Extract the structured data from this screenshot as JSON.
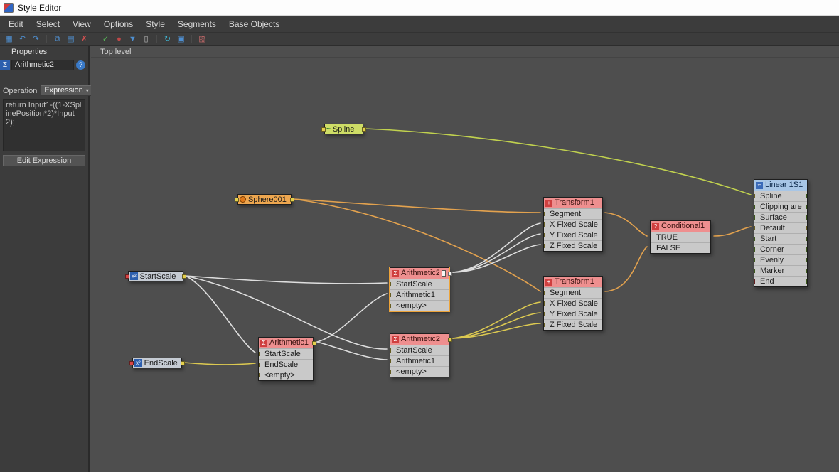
{
  "window": {
    "title": "Style Editor"
  },
  "menubar": {
    "items": [
      "Edit",
      "Select",
      "View",
      "Options",
      "Style",
      "Segments",
      "Base Objects"
    ]
  },
  "toolbar": {
    "icons": [
      {
        "name": "compare",
        "glyph": "▦",
        "css": "color:#4f8fd0"
      },
      {
        "name": "undo",
        "glyph": "↶",
        "css": "color:#4f8fd0"
      },
      {
        "name": "redo",
        "glyph": "↷",
        "css": "color:#4f8fd0"
      },
      {
        "name": "copy",
        "glyph": "⧉",
        "css": "color:#4f8fd0"
      },
      {
        "name": "paste",
        "glyph": "▤",
        "css": "color:#4f8fd0"
      },
      {
        "name": "delete",
        "glyph": "✗",
        "css": "color:#d05050"
      },
      {
        "name": "apply",
        "glyph": "✓",
        "css": "color:#58b858"
      },
      {
        "name": "mute",
        "glyph": "●",
        "css": "color:#c04848"
      },
      {
        "name": "filter",
        "glyph": "▼",
        "css": "color:#4f8fd0"
      },
      {
        "name": "trash",
        "glyph": "▯",
        "css": "color:#b8b8b8"
      },
      {
        "name": "refresh",
        "glyph": "↻",
        "css": "color:#3fb3d0"
      },
      {
        "name": "frame",
        "glyph": "▣",
        "css": "color:#4f8fd0"
      },
      {
        "name": "layout",
        "glyph": "▧",
        "css": "color:#c06868"
      }
    ]
  },
  "panel": {
    "tab": "Properties",
    "node_name": "Arithmetic2",
    "operation_label": "Operation",
    "operation_value": "Expression",
    "operation_caret": "▾",
    "expression": "return Input1-((1-XSplinePosition*2)*Input2);",
    "edit_button": "Edit Expression"
  },
  "canvas": {
    "breadcrumb": "Top level"
  },
  "icon_glyphs": {
    "sigma": "Σ",
    "help": "?",
    "arithmetic": "Σ",
    "transform": "+",
    "conditional": "?",
    "linear": "≈",
    "spline_wave": "~",
    "x_squared": "x²"
  },
  "nodes": {
    "spline": {
      "label": "Spline"
    },
    "sphere": {
      "label": "Sphere001"
    },
    "startscale": {
      "label": "StartScale"
    },
    "endscale": {
      "label": "EndScale"
    },
    "arithmetic1": {
      "title": "Arithmetic1",
      "rows": [
        "StartScale",
        "EndScale",
        "<empty>"
      ]
    },
    "arithmetic2a": {
      "title": "Arithmetic2",
      "rows": [
        "StartScale",
        "Arithmetic1",
        "<empty>"
      ],
      "selected": true
    },
    "arithmetic2b": {
      "title": "Arithmetic2",
      "rows": [
        "StartScale",
        "Arithmetic1",
        "<empty>"
      ]
    },
    "transform1a": {
      "title": "Transform1",
      "rows": [
        "Segment",
        "X Fixed Scale",
        "Y Fixed Scale",
        "Z Fixed Scale"
      ]
    },
    "transform1b": {
      "title": "Transform1",
      "rows": [
        "Segment",
        "X Fixed Scale",
        "Y Fixed Scale",
        "Z Fixed Scale"
      ]
    },
    "conditional1": {
      "title": "Conditional1",
      "rows": [
        "TRUE",
        "FALSE"
      ]
    },
    "linear": {
      "title": "Linear 1S1",
      "rows": [
        "Spline",
        "Clipping are",
        "Surface",
        "Default",
        "Start",
        "Corner",
        "Evenly",
        "Marker",
        "End"
      ]
    }
  },
  "connections": [
    {
      "from": "Spline",
      "to": "Linear 1S1 / Spline",
      "color": "green"
    },
    {
      "from": "Sphere001",
      "to": "Transform1 (top) / Segment",
      "color": "orange"
    },
    {
      "from": "Sphere001",
      "to": "Transform1 (bottom) / Segment",
      "color": "orange"
    },
    {
      "from": "StartScale",
      "to": "Arithmetic2 (top) / StartScale",
      "color": "white"
    },
    {
      "from": "StartScale",
      "to": "Arithmetic1 / StartScale",
      "color": "white"
    },
    {
      "from": "StartScale",
      "to": "Arithmetic2 (bottom) / StartScale",
      "color": "white"
    },
    {
      "from": "EndScale",
      "to": "Arithmetic1 / EndScale",
      "color": "yellow"
    },
    {
      "from": "Arithmetic1",
      "to": "Arithmetic2 (top) / Arithmetic1",
      "color": "white"
    },
    {
      "from": "Arithmetic1",
      "to": "Arithmetic2 (bottom) / Arithmetic1",
      "color": "white"
    },
    {
      "from": "Arithmetic2 (top)",
      "to": "Transform1 (top) / X,Y,Z Fixed Scale",
      "color": "white"
    },
    {
      "from": "Arithmetic2 (bottom)",
      "to": "Transform1 (bottom) / X,Y,Z Fixed Scale",
      "color": "yellow"
    },
    {
      "from": "Transform1 (top)",
      "to": "Conditional1 / TRUE",
      "color": "orange"
    },
    {
      "from": "Transform1 (bottom)",
      "to": "Conditional1 / FALSE",
      "color": "orange"
    },
    {
      "from": "Conditional1",
      "to": "Linear 1S1 / Default",
      "color": "orange"
    }
  ],
  "colors": {
    "wire_green": "#c1d24e",
    "wire_orange": "#e3a24e",
    "wire_white": "#dedede",
    "wire_yellow": "#dcc951",
    "port_yellow": "#e3cf4c",
    "port_green": "#86c33e",
    "port_red": "#d84545",
    "header_red": "#ee8f8f",
    "header_blue": "#a8c6e6",
    "selection": "#eda43a",
    "canvas_bg": "#4e4e4e",
    "panel_bg": "#3c3c3c"
  }
}
